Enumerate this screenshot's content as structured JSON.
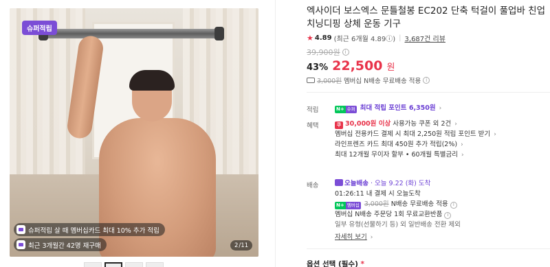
{
  "gallery": {
    "badge": "슈퍼적립",
    "chip1": "슈퍼적립 살 때 멤버십카드 최대 10% 추가 적립",
    "chip2": "최근 3개월간 42명 재구매",
    "pager_current": "2",
    "pager_total": "/11",
    "thumb_count": 4
  },
  "product": {
    "title": "엑사이더 보스엑스 문틀철봉 EC202 단축 턱걸이 풀업바 친업 치닝디핑 상체 운동 기구",
    "rating": "4.89",
    "rating_recent": "(최근 6개월 4.89",
    "rating_info": "ⓘ)",
    "review_count": "3,687건 리뷰",
    "original_price": "39,900원",
    "discount": "43%",
    "price": "22,500",
    "won": "원",
    "shipping_old": "3,000원",
    "shipping_text": "멤버십 N배송 무료배송 적용"
  },
  "reward": {
    "label": "적립",
    "npay_g": "N+",
    "npay_p": "슈퍼",
    "text": "최대 적립 포인트 6,350원"
  },
  "benefit": {
    "label": "혜택",
    "coupon_icon": "쿠",
    "coupon_highlight": "30,000원 이상",
    "coupon_rest": " 사용가능 쿠폰 외 2건",
    "line2": "멤버십 전용카드 결제 시 최대 2,250원 적립 포인트 받기",
    "line3": "라인프렌즈 카드 최대 450원 추가 적립(2%)",
    "line4": "최대 12개월 무이자 할부 • 60개월 특별금리"
  },
  "delivery": {
    "label": "배송",
    "today": "오늘배송",
    "today_date": "· 오늘 9.22 (화) 도착",
    "timer": "01:26:11",
    "timer_rest": "내 결제 시 오늘도착",
    "npay_g": "N+",
    "npay_p": "멤버십",
    "fee_old": "3,000원",
    "fee_text": "N배송 무료배송 적용",
    "line3": "멤버십 N배송 주문당 1회 무료교환반품",
    "line4": "일부 유형(선물하기 등) 외 일반배송 전환 제외",
    "more": "자세히 보기"
  },
  "options": {
    "title": "옵션 선택 (필수)",
    "required_mark": "*"
  },
  "colors": {
    "accent_red": "#e8334a",
    "accent_purple": "#7b4dd6",
    "npay_green": "#03c75a"
  }
}
